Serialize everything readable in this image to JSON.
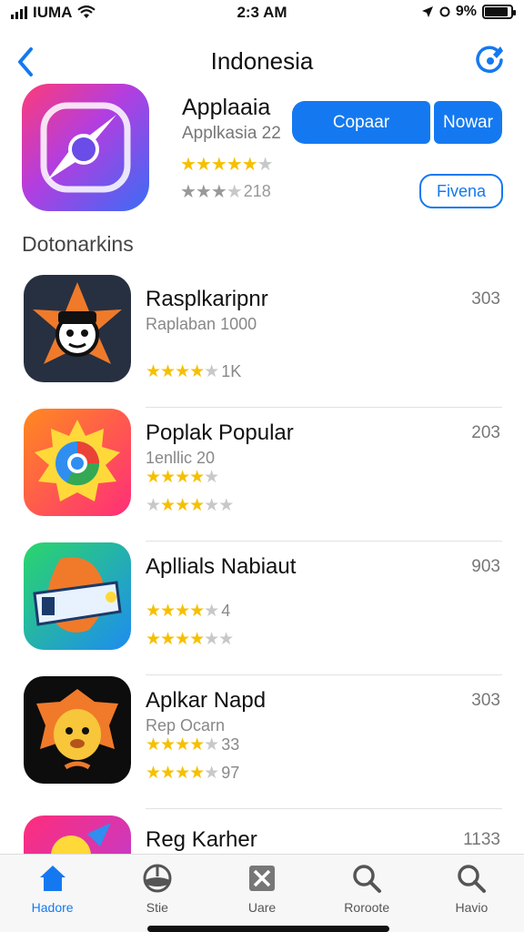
{
  "status_bar": {
    "carrier": "IUMA",
    "time": "2:3 AM",
    "battery": "9%",
    "battery_level": 0.9
  },
  "nav": {
    "title": "Indonesia",
    "back_icon": "chevron-left-icon",
    "share_icon": "share-icon"
  },
  "featured": {
    "name": "Applaaia",
    "subtitle": "Applkasia 22",
    "rating_count": "218",
    "primary_button": "Copaar",
    "secondary_button": "Nowar",
    "outline_button": "Fivena"
  },
  "section_title": "Dotonarkins",
  "apps": [
    {
      "name": "Rasplkaripnr",
      "subtitle": "Raplaban 1000",
      "rating_label": "1K",
      "rating2_label": "",
      "size": "303"
    },
    {
      "name": "Poplak Popular",
      "subtitle": "1enllic 20",
      "rating_label": "",
      "rating2_label": "",
      "size": "203"
    },
    {
      "name": "Apllials Nabiaut",
      "subtitle": "",
      "rating_label": "4",
      "rating2_label": "",
      "size": "903"
    },
    {
      "name": "Aplkar Napd",
      "subtitle": "Rep Ocarn",
      "rating_label": "33",
      "rating2_label": "97",
      "size": "303"
    },
    {
      "name": "Reg Karher",
      "subtitle": "",
      "rating_label": "",
      "rating2_label": "",
      "size": "1133"
    }
  ],
  "tabs": [
    {
      "label": "Hadore",
      "icon": "home-icon"
    },
    {
      "label": "Stie",
      "icon": "globe-icon"
    },
    {
      "label": "Uare",
      "icon": "apps-icon"
    },
    {
      "label": "Roroote",
      "icon": "search-icon"
    },
    {
      "label": "Havio",
      "icon": "search-icon"
    }
  ],
  "colors": {
    "accent": "#1479f0",
    "star": "#f6c000"
  }
}
